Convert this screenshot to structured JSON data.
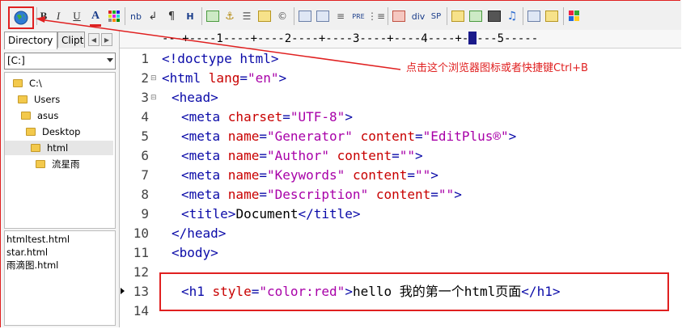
{
  "toolbar": {
    "browser_button": "view-in-browser",
    "buttons": [
      "B",
      "I",
      "U",
      "A",
      "nb",
      "↲",
      "¶",
      "H",
      "div",
      "SP",
      "PRE"
    ]
  },
  "left_panel": {
    "tabs": [
      "Directory",
      "Clipt"
    ],
    "drive": "[C:]",
    "tree": [
      {
        "label": "C:\\",
        "depth": 0
      },
      {
        "label": "Users",
        "depth": 1
      },
      {
        "label": "asus",
        "depth": 2
      },
      {
        "label": "Desktop",
        "depth": 3
      },
      {
        "label": "html",
        "depth": 4,
        "selected": true
      },
      {
        "label": "流星雨",
        "depth": 5
      }
    ],
    "files": [
      "htmltest.html",
      "star.html",
      "雨滴图.html"
    ]
  },
  "ruler": {
    "text": "---+----1----+----2----+----3----+----4----+-",
    "text_after": "---5-----"
  },
  "editor": {
    "line_numbers": [
      "1",
      "2",
      "3",
      "4",
      "5",
      "6",
      "7",
      "8",
      "9",
      "10",
      "11",
      "12",
      "13",
      "14"
    ],
    "lines": {
      "l1": "<!doctype html>",
      "l2_tag": "<html ",
      "l2_attr": "lang",
      "l2_eq": "=",
      "l2_val": "\"en\"",
      "l2_end": ">",
      "l3": "<head>",
      "l4_tag": "<meta ",
      "l4_attr": "charset",
      "l4_val": "\"UTF-8\"",
      "l5_attr1": "name",
      "l5_val1": "\"Generator\"",
      "l5_attr2": "content",
      "l5_val2": "\"EditPlus®\"",
      "l6_val1": "\"Author\"",
      "l6_val2": "\"\"",
      "l7_val1": "\"Keywords\"",
      "l8_val1": "\"Description\"",
      "l9_open": "<title>",
      "l9_text": "Document",
      "l9_close": "</title>",
      "l10": "</head>",
      "l12": "<body>",
      "l13_open": "<h1 ",
      "l13_attr": "style",
      "l13_val": "\"color:red\"",
      "l13_text": "hello 我的第一个html页面",
      "l13_close": "</h1>"
    }
  },
  "annotation": "点击这个浏览器图标或者快捷键Ctrl+B",
  "colors": {
    "tag": "#0a0aa8",
    "attribute": "#c80000",
    "string": "#a800a8",
    "annotation": "#e02020"
  }
}
